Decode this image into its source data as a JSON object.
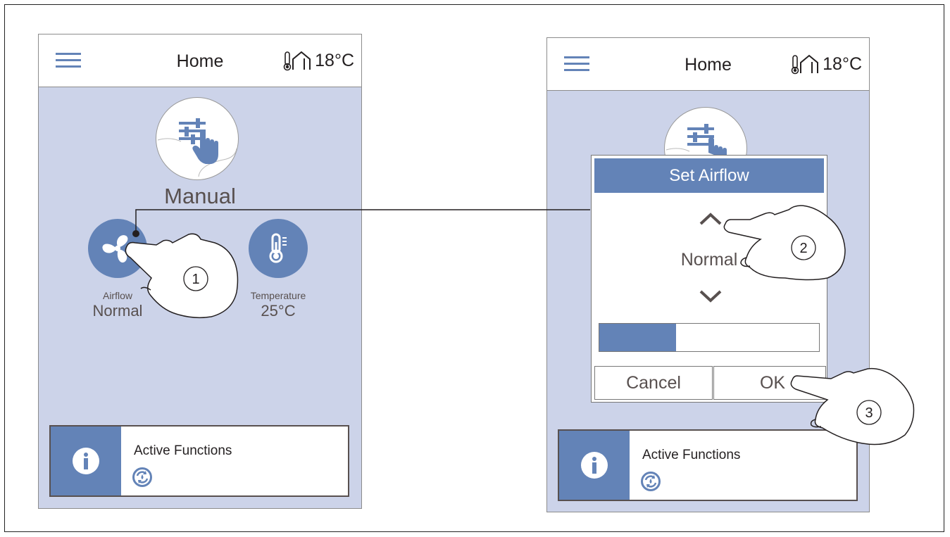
{
  "left_screen": {
    "header": {
      "title": "Home",
      "temperature": "18°C"
    },
    "mode": {
      "label": "Manual"
    },
    "airflow": {
      "label": "Airflow",
      "value": "Normal"
    },
    "temperature": {
      "label": "Temperature",
      "value": "25°C"
    },
    "active_functions": {
      "label": "Active Functions"
    }
  },
  "right_screen": {
    "header": {
      "title": "Home",
      "temperature": "18°C"
    },
    "dialog": {
      "title": "Set Airflow",
      "value": "Normal",
      "level": 0.35,
      "cancel_label": "Cancel",
      "ok_label": "OK"
    },
    "active_functions": {
      "label": "Active Functions"
    }
  },
  "steps": {
    "one": "1",
    "two": "2",
    "three": "3"
  },
  "colors": {
    "accent": "#6383b7",
    "background": "#ccd3e9",
    "text": "#58504f"
  },
  "icons": [
    "menu-icon",
    "house-thermometer-icon",
    "manual-hand-icon",
    "fan-icon",
    "thermometer-icon",
    "info-icon",
    "active-function-icon",
    "chevron-up-icon",
    "chevron-down-icon",
    "pointing-hand-icon"
  ]
}
